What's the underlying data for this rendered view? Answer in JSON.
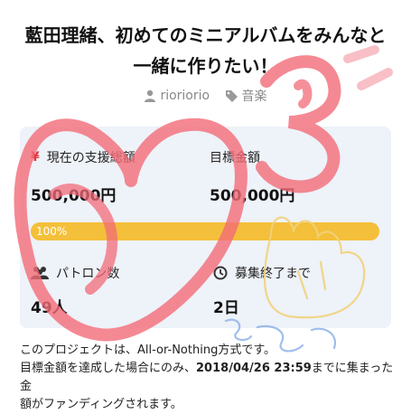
{
  "project": {
    "title_line1": "藍田理緒、初めてのミニアルバムをみんなと",
    "title_line2": "一緒に作りたい！",
    "author": "rioriorio",
    "category": "音楽"
  },
  "stats": {
    "raised_label": "現在の支援総額",
    "raised_value": "500,000円",
    "goal_label": "目標金額",
    "goal_value": "500,000円",
    "progress_text": "100%",
    "progress_fraction": 1.0,
    "patrons_label": "パトロン数",
    "patrons_value": "49人",
    "deadline_label": "募集終了まで",
    "deadline_value": "2日"
  },
  "notes": {
    "line1": "このプロジェクトは、All-or-Nothing方式です。",
    "line2_pre": "目標金額を達成した場合にのみ、",
    "line2_date": "2018/04/26 23:59",
    "line2_post": "までに集まった金",
    "line3": "額がファンディングされます。"
  },
  "icons": {
    "yen": "yen-icon",
    "user": "user-icon",
    "tag": "tag-icon",
    "users": "users-icon",
    "clock": "clock-icon"
  },
  "colors": {
    "accent": "#f4bf3a",
    "yen": "#e0373f",
    "card_bg": "#eef2f9",
    "doodle_red": "#f26b78",
    "doodle_yellow": "#f1d27a",
    "doodle_blue": "#8fb3ea"
  }
}
